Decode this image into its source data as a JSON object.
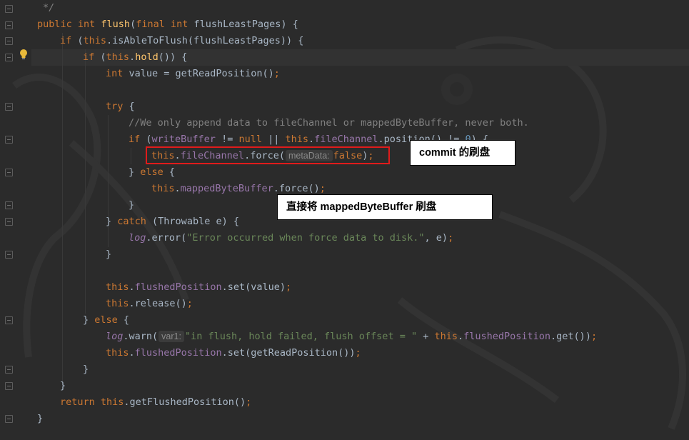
{
  "code": {
    "l0_cmt": "*/",
    "l1": {
      "kw1": "public ",
      "kw2": "int ",
      "fn": "flush",
      "p1": "(",
      "kw3": "final ",
      "kw4": "int ",
      "p2": "flushLeastPages) {"
    },
    "l2": {
      "kw": "if ",
      "p1": "(",
      "this": "this",
      "p2": ".isAbleToFlush(flushLeastPages)) {"
    },
    "l3": {
      "kw": "if ",
      "p1": "(",
      "this": "this",
      "p2": ".",
      "fn": "hold",
      "p3": "()) {"
    },
    "l4": {
      "kw": "int ",
      "p1": "value = getReadPosition()",
      "semi": ";"
    },
    "l5": {
      "kw": "try ",
      "p1": "{"
    },
    "l6_cmt": "//We only append data to fileChannel or mappedByteBuffer, never both.",
    "l7": {
      "kw": "if ",
      "p1": "(",
      "f1": "writeBuffer",
      "p2": " != ",
      "kw2": "null ",
      "p3": "|| ",
      "this": "this",
      "p4": ".",
      "f2": "fileChannel",
      "p5": ".position() != ",
      "num": "0",
      "p6": ") {"
    },
    "l8": {
      "this": "this",
      "p1": ".",
      "f1": "fileChannel",
      "p2": ".force(",
      "hint": "metaData:",
      "kw": "false",
      "p3": ")",
      "semi": ";"
    },
    "l9": {
      "p1": "} ",
      "kw": "else ",
      "p2": "{"
    },
    "l10": {
      "this": "this",
      "p1": ".",
      "f1": "mappedByteBuffer",
      "p2": ".force()",
      "semi": ";"
    },
    "l11": "}",
    "l12": {
      "p1": "} ",
      "kw": "catch ",
      "p2": "(Throwable e) {"
    },
    "l13": {
      "log": "log",
      "p1": ".error(",
      "str": "\"Error occurred when force data to disk.\"",
      "p2": ", e)",
      "semi": ";"
    },
    "l14": "}",
    "l15": {
      "this": "this",
      "p1": ".",
      "f1": "flushedPosition",
      "p2": ".set(value)",
      "semi": ";"
    },
    "l16": {
      "this": "this",
      "p1": ".release()",
      "semi": ";"
    },
    "l17": {
      "p1": "} ",
      "kw": "else ",
      "p2": "{"
    },
    "l18": {
      "log": "log",
      "p1": ".warn(",
      "hint": "var1:",
      "str": "\"in flush, hold failed, flush offset = \"",
      "p2": " + ",
      "this": "this",
      "p3": ".",
      "f1": "flushedPosition",
      "p4": ".get())",
      "semi": ";"
    },
    "l19": {
      "this": "this",
      "p1": ".",
      "f1": "flushedPosition",
      "p2": ".set(getReadPosition())",
      "semi": ";"
    },
    "l20": "}",
    "l21": "}",
    "l22": {
      "kw": "return ",
      "this": "this",
      "p1": ".getFlushedPosition()",
      "semi": ";"
    },
    "l23": "}"
  },
  "annotations": {
    "commit_label": "commit 的刷盘",
    "mapped_label": "直接将 mappedByteBuffer 刷盘"
  },
  "icons": {
    "gutter": "lightbulb-icon",
    "fold": "fold-marker-icon"
  },
  "colors": {
    "background": "#2b2b2b",
    "keyword": "#cc7832",
    "method": "#ffc66d",
    "field": "#9876aa",
    "string": "#6a8759",
    "comment": "#808080",
    "highlight": "#e01b1b"
  }
}
